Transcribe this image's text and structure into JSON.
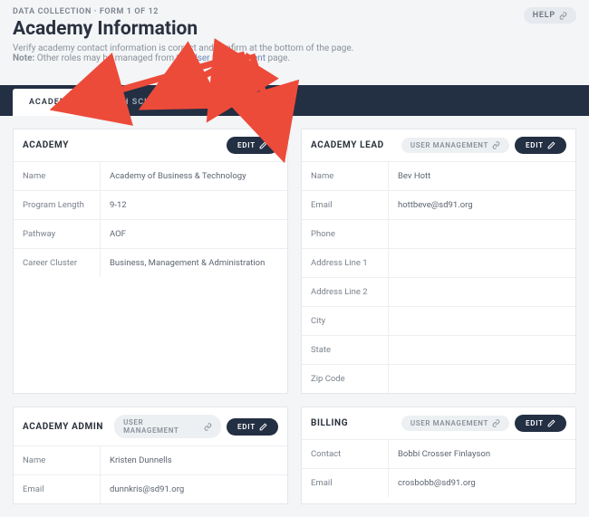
{
  "header": {
    "crumb": "DATA COLLECTION · FORM 1 OF 12",
    "title": "Academy Information",
    "subtitle_pre": "Verify academy contact information is correct and confirm at the bottom of the page.",
    "subtitle_note_label": "Note:",
    "subtitle_note": " Other roles may be managed from the ",
    "subtitle_link": "User Management",
    "subtitle_post": " page.",
    "help_label": "HELP"
  },
  "tabs": {
    "academy": "ACADEMY",
    "highschool": "HIGH SCHOOL",
    "district": "DISTRICT"
  },
  "buttons": {
    "edit": "EDIT",
    "user_management": "USER MANAGEMENT"
  },
  "cards": {
    "academy": {
      "title": "ACADEMY",
      "rows": {
        "name_label": "Name",
        "name_value": "Academy of Business & Technology",
        "program_label": "Program Length",
        "program_value": "9-12",
        "pathway_label": "Pathway",
        "pathway_value": "AOF",
        "cluster_label": "Career Cluster",
        "cluster_value": "Business, Management & Administration"
      }
    },
    "lead": {
      "title": "ACADEMY LEAD",
      "rows": {
        "name_label": "Name",
        "name_value": "Bev Hott",
        "email_label": "Email",
        "email_value": "hottbeve@sd91.org",
        "phone_label": "Phone",
        "phone_value": "",
        "addr1_label": "Address Line 1",
        "addr1_value": "",
        "addr2_label": "Address Line 2",
        "addr2_value": "",
        "city_label": "City",
        "city_value": "",
        "state_label": "State",
        "state_value": "",
        "zip_label": "Zip Code",
        "zip_value": ""
      }
    },
    "admin": {
      "title": "ACADEMY ADMIN",
      "rows": {
        "name_label": "Name",
        "name_value": "Kristen Dunnells",
        "email_label": "Email",
        "email_value": "dunnkris@sd91.org"
      }
    },
    "billing": {
      "title": "BILLING",
      "rows": {
        "contact_label": "Contact",
        "contact_value": "Bobbi Crosser Finlayson",
        "email_label": "Email",
        "email_value": "crosbobb@sd91.org"
      }
    }
  }
}
